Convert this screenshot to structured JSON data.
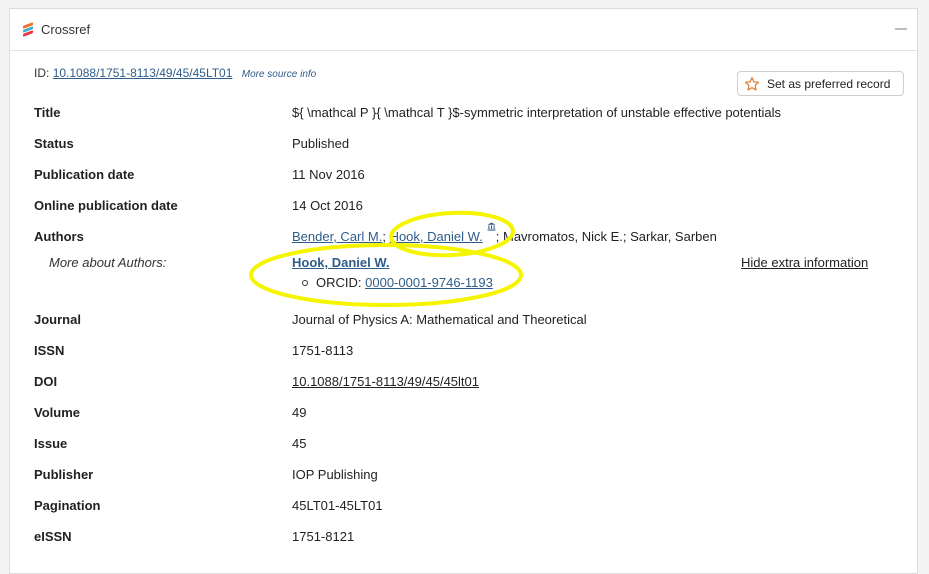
{
  "header": {
    "title": "Crossref"
  },
  "record": {
    "id_prefix": "ID:",
    "id_value": "10.1088/1751-8113/49/45/45LT01",
    "more_source": "More source info",
    "preferred_button": "Set as preferred record"
  },
  "fields": {
    "title": {
      "label": "Title",
      "value": "${ \\mathcal P }{ \\mathcal T }$-symmetric interpretation of unstable effective potentials"
    },
    "status": {
      "label": "Status",
      "value": "Published"
    },
    "pub_date": {
      "label": "Publication date",
      "value": "11 Nov 2016"
    },
    "online_date": {
      "label": "Online publication date",
      "value": "14 Oct 2016"
    },
    "authors": {
      "label": "Authors",
      "author1": "Bender, Carl M.",
      "sep1": "; ",
      "author2": "Hook, Daniel W.",
      "rest": "; Mavromatos, Nick E.; Sarkar, Sarben"
    },
    "more_about": {
      "label": "More about Authors:",
      "author_name": "Hook, Daniel W.",
      "orcid_label": "ORCID: ",
      "orcid_value": "0000-0001-9746-1193",
      "hide_link": "Hide extra information"
    },
    "journal": {
      "label": "Journal",
      "value": "Journal of Physics A: Mathematical and Theoretical"
    },
    "issn": {
      "label": "ISSN",
      "value": "1751-8113"
    },
    "doi": {
      "label": "DOI",
      "value": "10.1088/1751-8113/49/45/45lt01"
    },
    "volume": {
      "label": "Volume",
      "value": "49"
    },
    "issue": {
      "label": "Issue",
      "value": "45"
    },
    "publisher": {
      "label": "Publisher",
      "value": "IOP Publishing"
    },
    "pagination": {
      "label": "Pagination",
      "value": "45LT01-45LT01"
    },
    "eissn": {
      "label": "eISSN",
      "value": "1751-8121"
    }
  },
  "colors": {
    "link": "#2f5d8a",
    "annotation": "#f5f500",
    "star": "#e07a2c"
  },
  "icons": [
    "crossref-logo-icon",
    "minimize-icon",
    "star-icon",
    "institution-icon"
  ]
}
